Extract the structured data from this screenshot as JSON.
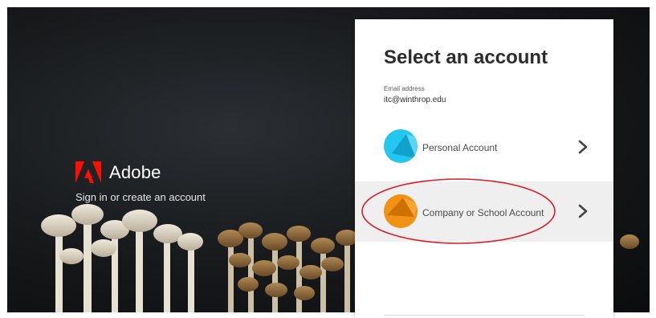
{
  "brand": {
    "name": "Adobe",
    "tagline": "Sign in or create an account"
  },
  "account_picker": {
    "title": "Select an account",
    "email_label": "Email address",
    "email_value": "itc@winthrop.edu",
    "accounts": [
      {
        "label": "Personal Account",
        "avatar_color": "#23c6ee",
        "selected": false
      },
      {
        "label": "Company or School Account",
        "avatar_color": "#f29112",
        "selected": true
      }
    ]
  },
  "colors": {
    "brand_red": "#fa0f00",
    "highlight_ring": "#d8202a",
    "selected_row_bg": "#efefef"
  }
}
